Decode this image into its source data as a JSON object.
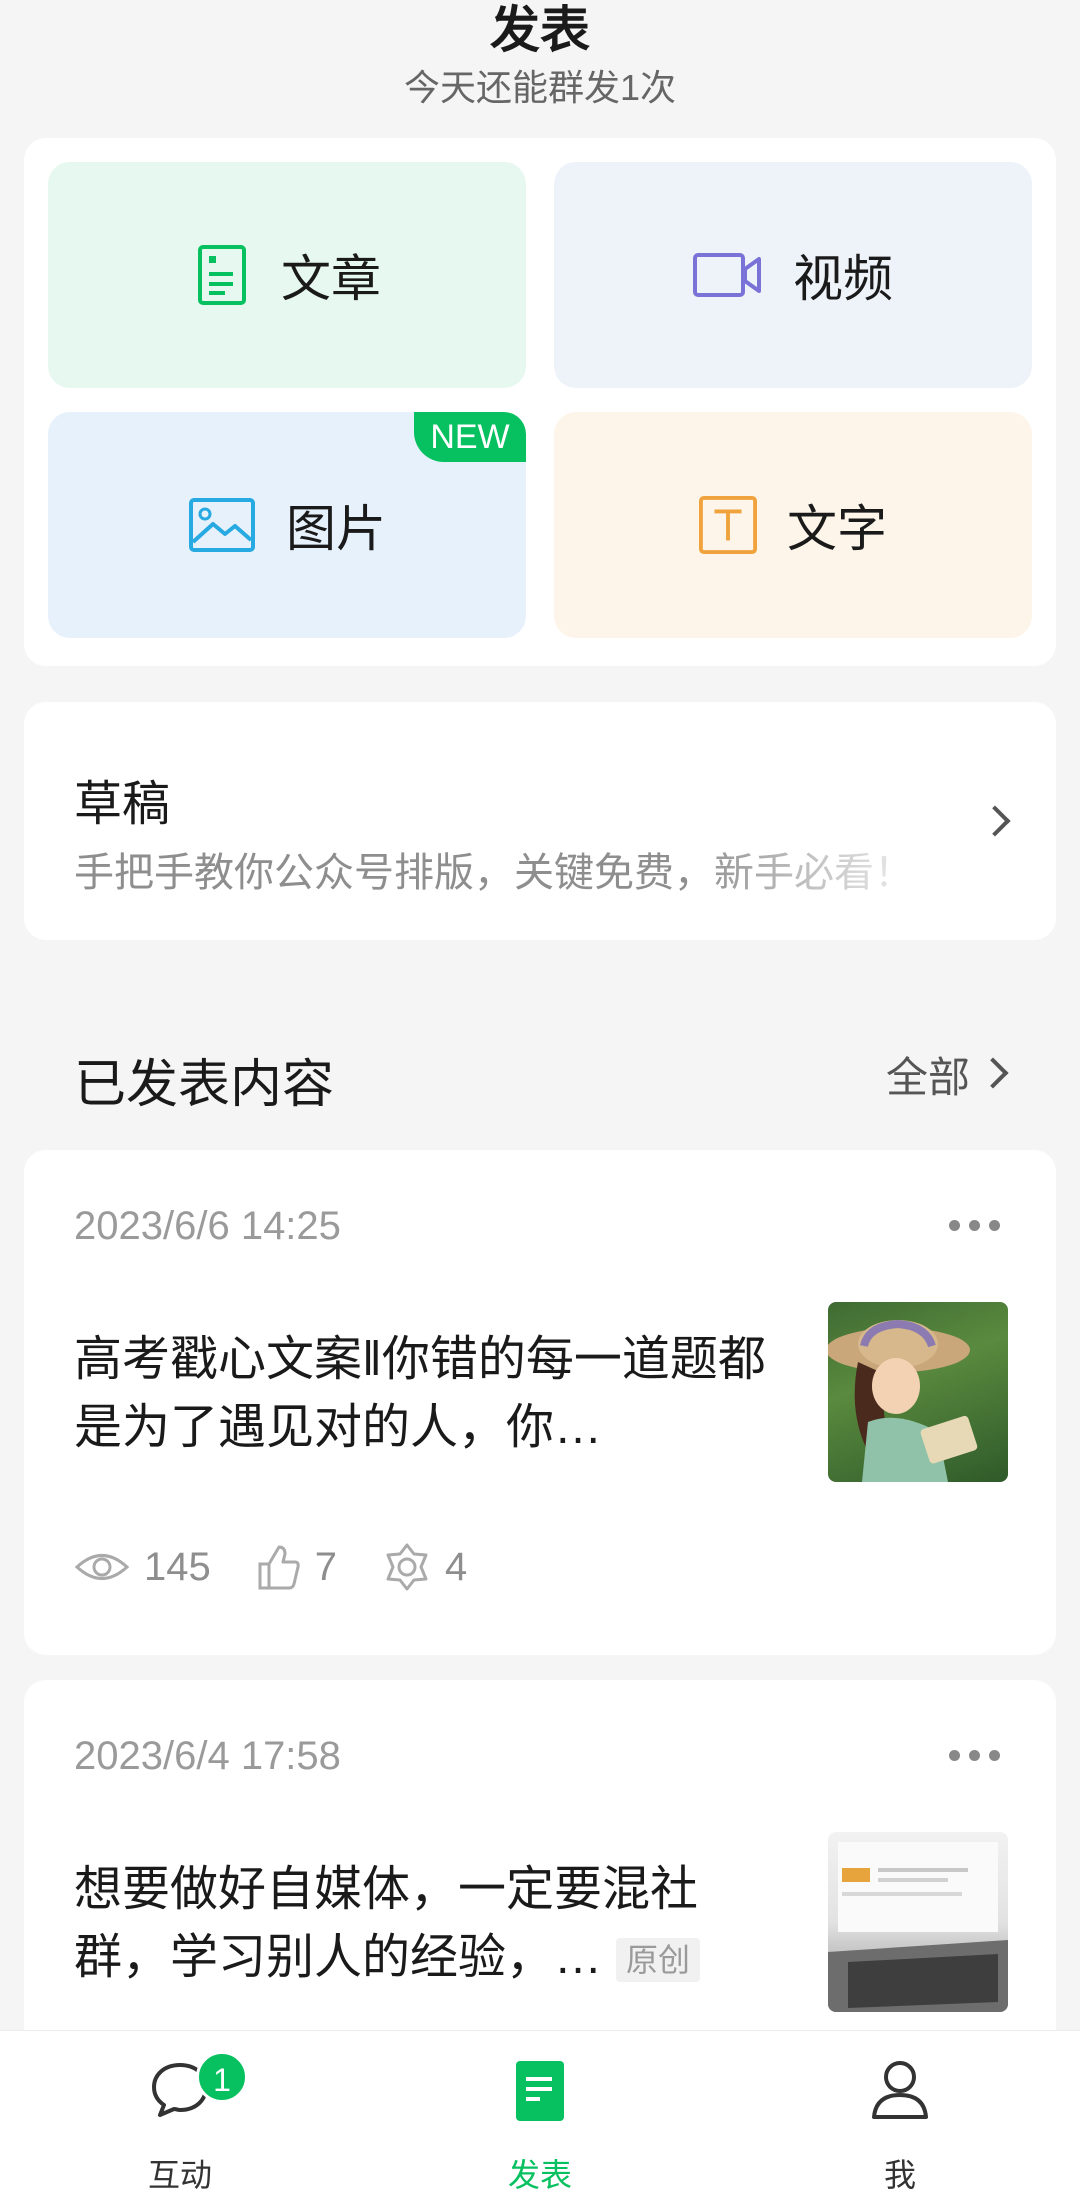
{
  "header": {
    "title": "发表",
    "subtitle": "今天还能群发1次"
  },
  "publish_options": [
    {
      "label": "文章",
      "icon": "article-icon",
      "color": "#07c160"
    },
    {
      "label": "视频",
      "icon": "video-icon",
      "color": "#7b72d8"
    },
    {
      "label": "图片",
      "icon": "image-icon",
      "color": "#27a9e1",
      "badge": "NEW"
    },
    {
      "label": "文字",
      "icon": "text-icon",
      "color": "#f0a33c"
    }
  ],
  "draft": {
    "title": "草稿",
    "description": "手把手教你公众号排版，关键免费，新手必看！"
  },
  "published": {
    "section_title": "已发表内容",
    "see_all_label": "全部",
    "posts": [
      {
        "time": "2023/6/6 14:25",
        "title": "高考戳心文案‖你错的每一道题都是为了遇见对的人，你…",
        "tag": "",
        "stats": {
          "views": "145",
          "likes": "7",
          "shares": "4"
        }
      },
      {
        "time": "2023/6/4 17:58",
        "title": "想要做好自媒体，一定要混社群，学习别人的经验，…",
        "tag": "原创"
      }
    ]
  },
  "tabbar": {
    "items": [
      {
        "label": "互动",
        "icon": "chat-bubble-icon",
        "badge": "1"
      },
      {
        "label": "发表",
        "icon": "document-icon",
        "active": true
      },
      {
        "label": "我",
        "icon": "person-icon"
      }
    ]
  },
  "colors": {
    "accent": "#07c160",
    "background": "#f5f5f5"
  }
}
